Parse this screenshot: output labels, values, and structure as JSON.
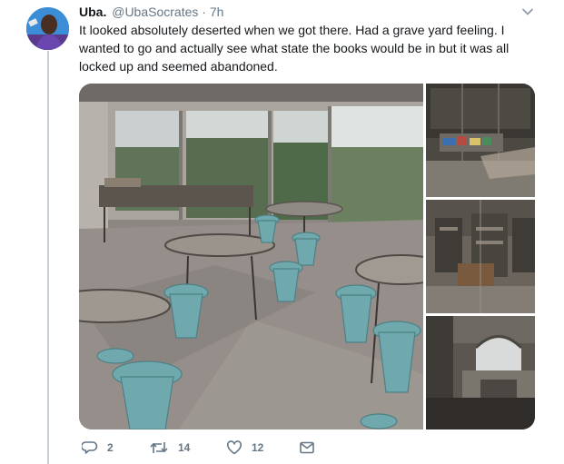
{
  "tweet": {
    "author_name": "Uba.",
    "author_handle": "@UbaSocrates",
    "separator": "·",
    "time": "7h",
    "text": "It looked absolutely deserted when we got there. Had a grave yard feeling. I wanted to go and actually see what state the books would be in but it was all locked up and seemed abandoned.",
    "stats": {
      "replies": "2",
      "retweets": "14",
      "likes": "12"
    }
  },
  "icons": {
    "menu": "chevron-down-icon",
    "reply": "reply-icon",
    "retweet": "retweet-icon",
    "like": "heart-icon",
    "dm": "envelope-icon"
  },
  "colors": {
    "secondary_text": "#657786",
    "thread_line": "#c4cfd6",
    "stool_teal": "#6fa8ad"
  }
}
